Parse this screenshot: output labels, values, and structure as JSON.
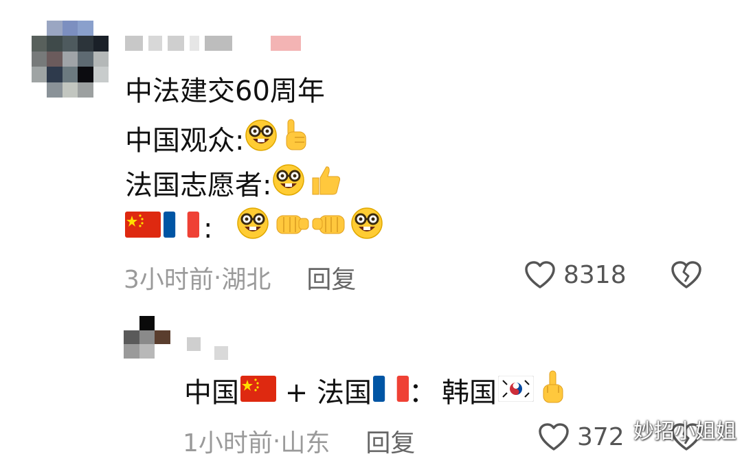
{
  "comment1": {
    "lines": {
      "l1": "中法建交60周年",
      "l2": "中国观众:",
      "l3": "法国志愿者:",
      "l4_colon": ":"
    },
    "time": "3小时前",
    "dot": " · ",
    "location": "湖北",
    "reply_label": "回复",
    "likes": "8318"
  },
  "reply1": {
    "text_china": "中国",
    "plus": " + ",
    "text_france": "法国",
    "colon": "：",
    "text_korea": "韩国",
    "time": "1小时前",
    "dot": " · ",
    "location": "山东",
    "reply_label": "回复",
    "likes": "372"
  },
  "watermark": "妙招小姐姐",
  "icons": {
    "nerd": "nerd-face-icon",
    "point_up": "pointing-up-icon",
    "thumbs_up": "thumbs-up-icon",
    "fist_left": "left-fist-icon",
    "fist_right": "right-fist-icon",
    "middle_finger": "middle-finger-icon",
    "heart": "heart-outline-icon",
    "broken_heart": "broken-heart-outline-icon"
  },
  "colors": {
    "text": "#111111",
    "meta": "#9a9a9a",
    "emoji_yellow": "#ffcc33",
    "china_red": "#de2910",
    "france_blue": "#0055a4",
    "france_red": "#ef4135"
  }
}
